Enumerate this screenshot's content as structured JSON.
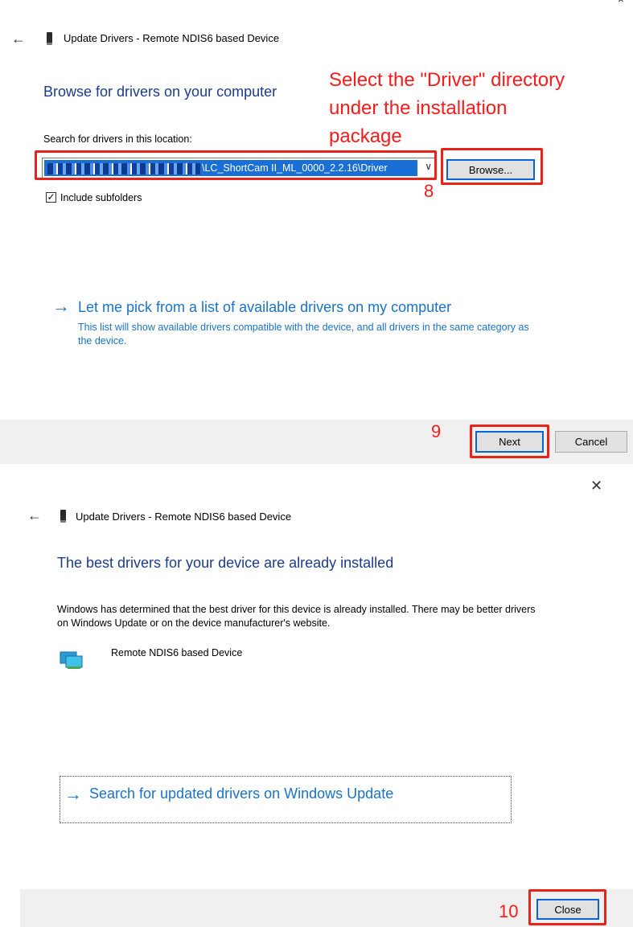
{
  "panel1": {
    "title": "Update Drivers - Remote NDIS6 based Device",
    "heading": "Browse for drivers on your computer",
    "search_label": "Search for drivers in this location:",
    "path_value": "\\LC_ShortCam II_ML_0000_2.2.16\\Driver",
    "browse_label": "Browse...",
    "include_subfolders_label": "Include subfolders",
    "include_subfolders_checked": true,
    "pick_link": "Let me pick from a list of available drivers on my computer",
    "pick_desc": "This list will show available drivers compatible with the device, and all drivers in the same category as the device.",
    "next_label": "Next",
    "cancel_label": "Cancel",
    "annotation_line1": "Select the \"Driver\" directory",
    "annotation_line2": "under the installation",
    "annotation_line3": "package",
    "step8": "8",
    "step9": "9"
  },
  "panel2": {
    "title": "Update Drivers - Remote NDIS6 based Device",
    "heading": "The best drivers for your device are already installed",
    "message": "Windows has determined that the best driver for this device is already installed. There may be better drivers on Windows Update or on the device manufacturer's website.",
    "device_name": "Remote NDIS6 based Device",
    "update_link": "Search for updated drivers on Windows Update",
    "close_label": "Close",
    "step10": "10"
  },
  "icons": {
    "back": "back-arrow-icon",
    "device": "device-icon",
    "network": "network-adapter-icon",
    "close": "close-icon",
    "link_arrow": "arrow-right-icon",
    "dropdown": "chevron-down-icon"
  },
  "colors": {
    "heading": "#1e3c8c",
    "link": "#1a73c8",
    "annotation": "#ff1a1a",
    "selection": "#1a6fd6",
    "footer": "#f0f0f0"
  }
}
